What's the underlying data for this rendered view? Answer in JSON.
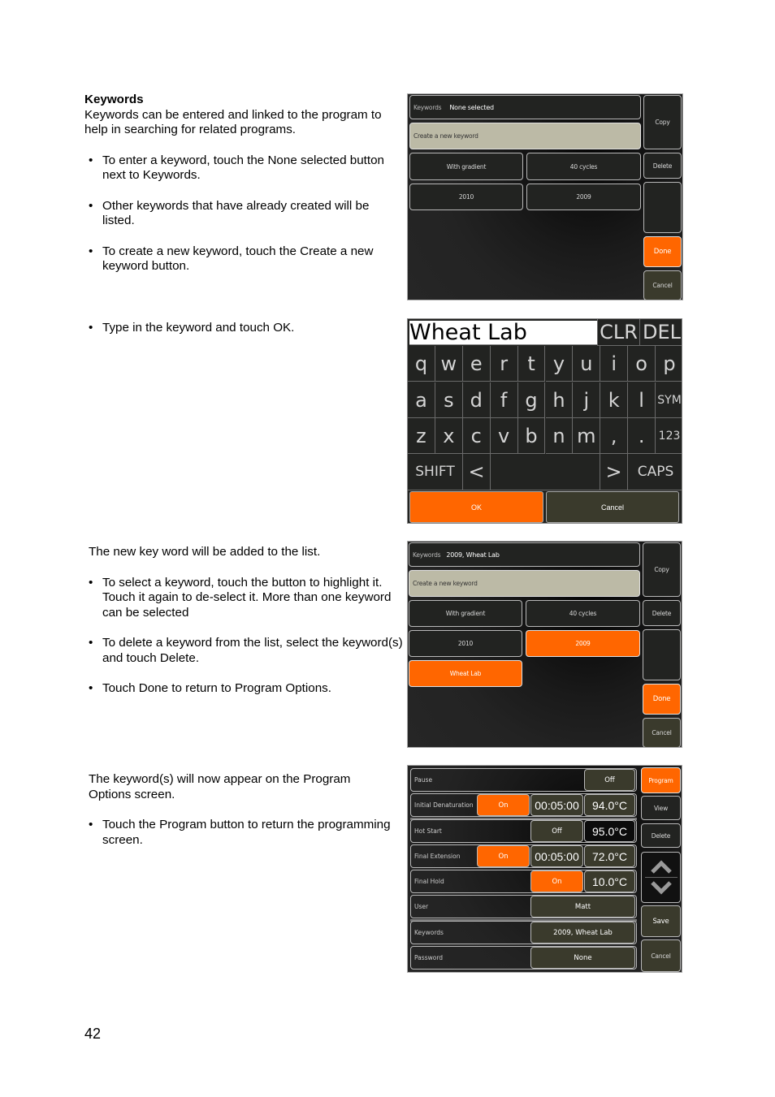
{
  "document": {
    "page_number": "42",
    "section1": {
      "heading": "Keywords",
      "intro": "Keywords can be entered and linked to the program to help in searching for related programs.",
      "bullets": [
        "To enter a keyword, touch the None selected button next to Keywords.",
        "Other keywords that have already created will be listed.",
        "To create a new keyword, touch the Create a new keyword button."
      ]
    },
    "section2": {
      "bullets": [
        "Type in the keyword and touch OK."
      ]
    },
    "section3": {
      "intro": "The new key word will be added to the list.",
      "bullets": [
        "To select a keyword, touch the button to highlight it. Touch it again to de-select it. More than one keyword can be selected",
        "To delete a keyword from the list, select the keyword(s) and touch Delete.",
        "Touch Done to return to Program Options."
      ]
    },
    "section4": {
      "intro": "The keyword(s) will now appear on the Program Options screen.",
      "bullets": [
        "Touch the Program button to return the programming screen."
      ]
    }
  },
  "screen1": {
    "keywords_label": "Keywords",
    "keywords_value": "None selected",
    "create_label": "Create a new keyword",
    "keywords": [
      {
        "label": "With gradient",
        "selected": false
      },
      {
        "label": "40 cycles",
        "selected": false
      },
      {
        "label": "2010",
        "selected": false
      },
      {
        "label": "2009",
        "selected": false
      }
    ],
    "side": {
      "copy": "Copy",
      "delete": "Delete",
      "done": "Done",
      "cancel": "Cancel"
    }
  },
  "keyboard": {
    "input_value": "Wheat Lab",
    "clr": "CLR",
    "del": "DEL",
    "row1": [
      "q",
      "w",
      "e",
      "r",
      "t",
      "y",
      "u",
      "i",
      "o",
      "p"
    ],
    "row2": [
      "a",
      "s",
      "d",
      "f",
      "g",
      "h",
      "j",
      "k",
      "l",
      "SYM"
    ],
    "row3": [
      "z",
      "x",
      "c",
      "v",
      "b",
      "n",
      "m",
      ",",
      ".",
      "123"
    ],
    "shift": "SHIFT",
    "left": "<",
    "right": ">",
    "caps": "CAPS",
    "ok": "OK",
    "cancel": "Cancel"
  },
  "screen3": {
    "keywords_label": "Keywords",
    "keywords_value": "2009, Wheat Lab",
    "create_label": "Create a new keyword",
    "keywords": [
      {
        "label": "With gradient",
        "selected": false
      },
      {
        "label": "40 cycles",
        "selected": false
      },
      {
        "label": "2010",
        "selected": false
      },
      {
        "label": "2009",
        "selected": true
      },
      {
        "label": "Wheat Lab",
        "selected": true
      }
    ],
    "side": {
      "copy": "Copy",
      "delete": "Delete",
      "done": "Done",
      "cancel": "Cancel"
    }
  },
  "program_options": {
    "rows": {
      "pause": {
        "label": "Pause",
        "state": "Off"
      },
      "initial_denaturation": {
        "label": "Initial Denaturation",
        "state": "On",
        "time": "00:05:00",
        "temp": "94.0°C"
      },
      "hot_start": {
        "label": "Hot Start",
        "state": "Off",
        "temp": "95.0°C"
      },
      "final_extension": {
        "label": "Final Extension",
        "state": "On",
        "time": "00:05:00",
        "temp": "72.0°C"
      },
      "final_hold": {
        "label": "Final Hold",
        "state": "On",
        "temp": "10.0°C"
      },
      "user": {
        "label": "User",
        "value": "Matt"
      },
      "keywords": {
        "label": "Keywords",
        "value": "2009, Wheat Lab"
      },
      "password": {
        "label": "Password",
        "value": "None"
      }
    },
    "side": {
      "program": "Program",
      "view": "View",
      "delete": "Delete",
      "save": "Save",
      "cancel": "Cancel"
    }
  },
  "colors": {
    "accent": "#ff6600",
    "khaki": "#bcbaa6",
    "olive": "#3a3a2c"
  }
}
